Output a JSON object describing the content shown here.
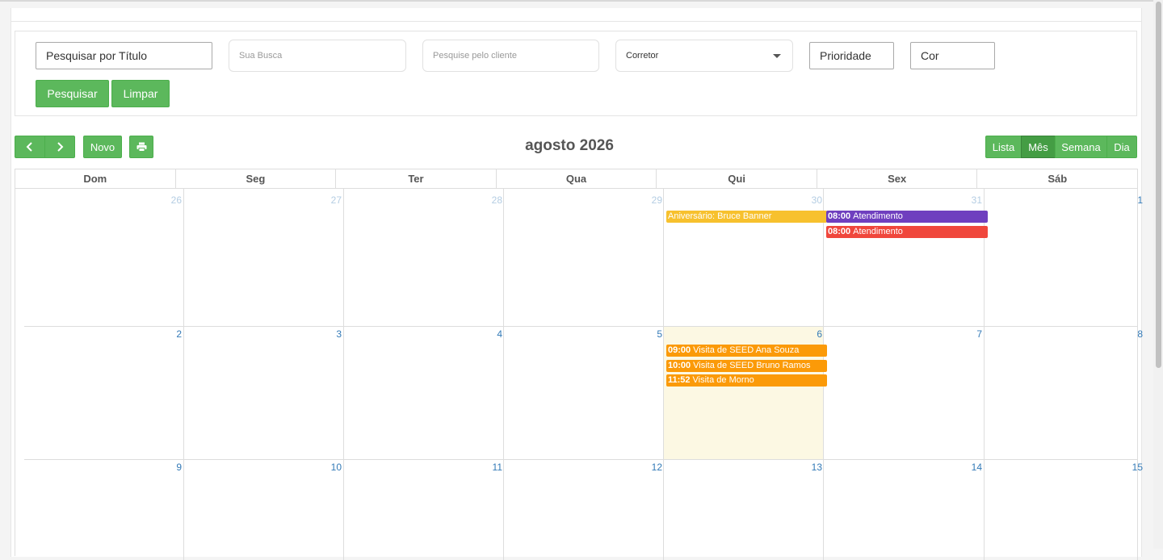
{
  "filters": {
    "title_value": "Pesquisar por Título",
    "search_placeholder": "Sua Busca",
    "client_placeholder": "Pesquise pelo cliente",
    "broker_selected": "Corretor",
    "priority_value": "Prioridade",
    "color_value": "Cor",
    "search_button": "Pesquisar",
    "clear_button": "Limpar"
  },
  "toolbar": {
    "new_button": "Novo",
    "month_title": "agosto 2026",
    "views": [
      "Lista",
      "Mês",
      "Semana",
      "Dia"
    ],
    "active_view": "Mês"
  },
  "weekdays": [
    "Dom",
    "Seg",
    "Ter",
    "Qua",
    "Qui",
    "Sex",
    "Sáb"
  ],
  "weeks": [
    [
      "26",
      "27",
      "28",
      "29",
      "30",
      "31",
      "1"
    ],
    [
      "2",
      "3",
      "4",
      "5",
      "6",
      "7",
      "8"
    ],
    [
      "9",
      "10",
      "11",
      "12",
      "13",
      "14",
      "15"
    ]
  ],
  "events": [
    {
      "time": "",
      "title": "Aniversário: Bruce Banner",
      "color": "#f7c12e"
    },
    {
      "time": "08:00",
      "title": "Atendimento",
      "color": "#6f3fbf"
    },
    {
      "time": "08:00",
      "title": "Atendimento",
      "color": "#f0473c"
    },
    {
      "time": "09:00",
      "title": "Visita de SEED Ana Souza",
      "color": "#fb9a08"
    },
    {
      "time": "10:00",
      "title": "Visita de SEED Bruno Ramos",
      "color": "#fb9a08"
    },
    {
      "time": "11:52",
      "title": "Visita de Morno",
      "color": "#fb9a08"
    }
  ],
  "colors": {
    "primary_button": "#5cb85c",
    "today_highlight": "#fcf8e3"
  }
}
